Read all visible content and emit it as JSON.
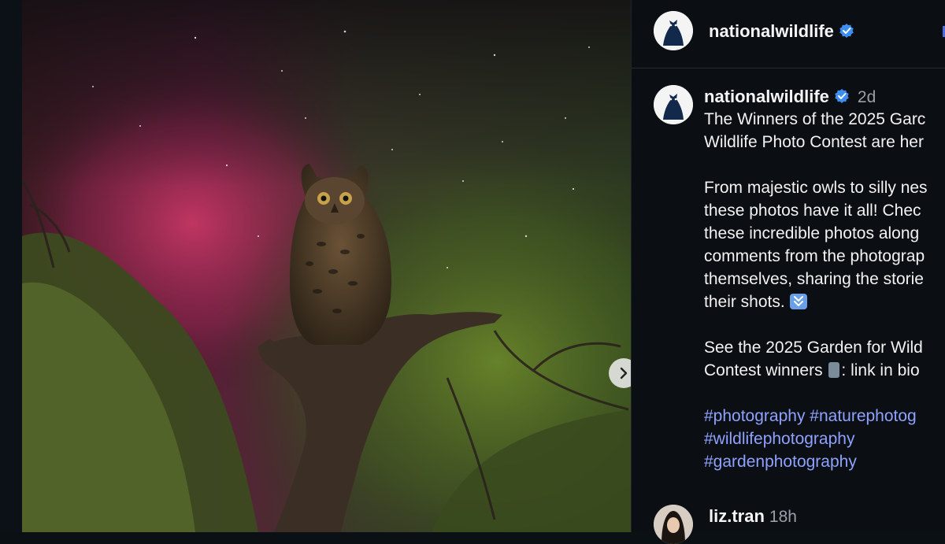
{
  "post": {
    "author": "nationalwildlife",
    "verified": true,
    "age": "2d",
    "caption_lines": [
      "The Winners of the 2025 Garc",
      "Wildlife Photo Contest are her",
      "",
      "From majestic owls to silly nes",
      "these photos have it all! Chec",
      "these incredible photos along",
      "comments from the photograp",
      "themselves, sharing the storie",
      "their shots."
    ],
    "see_lines": [
      "See the 2025 Garden for Wild",
      "Contest winners",
      ": link in bio"
    ],
    "hashtags": [
      "#photography #naturephotog",
      "#wildlifephotography",
      "#gardenphotography"
    ]
  },
  "comment": {
    "author": "liz.tran",
    "age": "18h"
  },
  "icons": {
    "next": "chevron-right-icon",
    "verified": "verified-badge-icon",
    "down_emoji": "double-down-arrow-emoji",
    "phone_emoji": "mobile-phone-arrow-emoji"
  },
  "colors": {
    "hashtag": "#8ea2ff",
    "verified": "#3d8ef0",
    "background": "#0b0f13"
  }
}
